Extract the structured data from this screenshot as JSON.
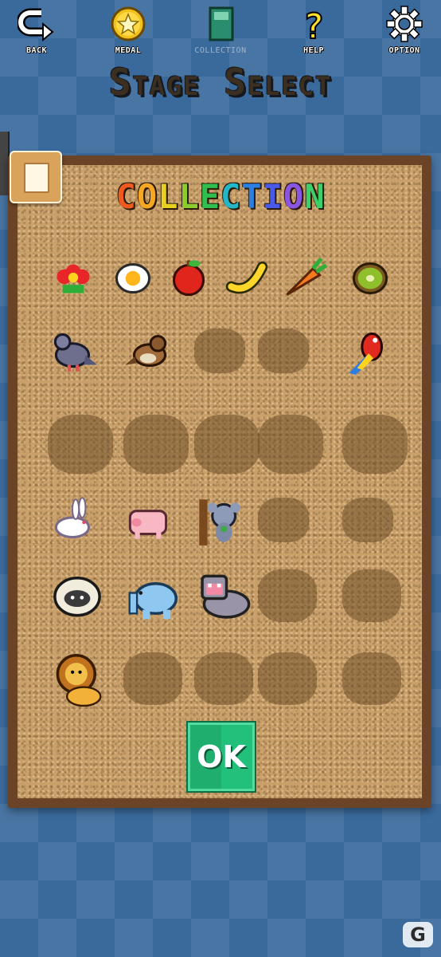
{
  "nav": {
    "back": {
      "label": "BACK",
      "icon": "back-arrow-icon"
    },
    "medal": {
      "label": "MEDAL",
      "icon": "medal-icon"
    },
    "collection": {
      "label": "COLLECTION",
      "icon": "book-icon"
    },
    "help": {
      "label": "HELP",
      "icon": "question-icon"
    },
    "option": {
      "label": "OPTION",
      "icon": "gear-icon"
    }
  },
  "screen_title": "Stage Select",
  "collection": {
    "title_letters": [
      "C",
      "O",
      "L",
      "L",
      "E",
      "C",
      "T",
      "I",
      "O",
      "N"
    ],
    "title_colors": [
      "#f05a1e",
      "#f5a623",
      "#e8d020",
      "#8ccc2c",
      "#2fbf4e",
      "#22b6c8",
      "#2a7fe0",
      "#4a5ae8",
      "#8a55e0",
      "#3bd06a"
    ],
    "rows": [
      [
        "flower",
        "egg",
        "apple",
        "banana",
        "carrot",
        "kiwi"
      ],
      [
        "pigeon",
        "sparrow",
        "locked",
        "locked",
        "parrot"
      ],
      [
        "locked",
        "locked",
        "locked",
        "locked",
        "locked"
      ],
      [
        "rabbit",
        "pig",
        "koala",
        "locked",
        "locked"
      ],
      [
        "sheep",
        "elephant",
        "hippo",
        "locked",
        "locked"
      ],
      [
        "lion",
        "locked",
        "locked",
        "locked",
        "locked"
      ]
    ]
  },
  "ok_label": "OK",
  "watermark": "G"
}
